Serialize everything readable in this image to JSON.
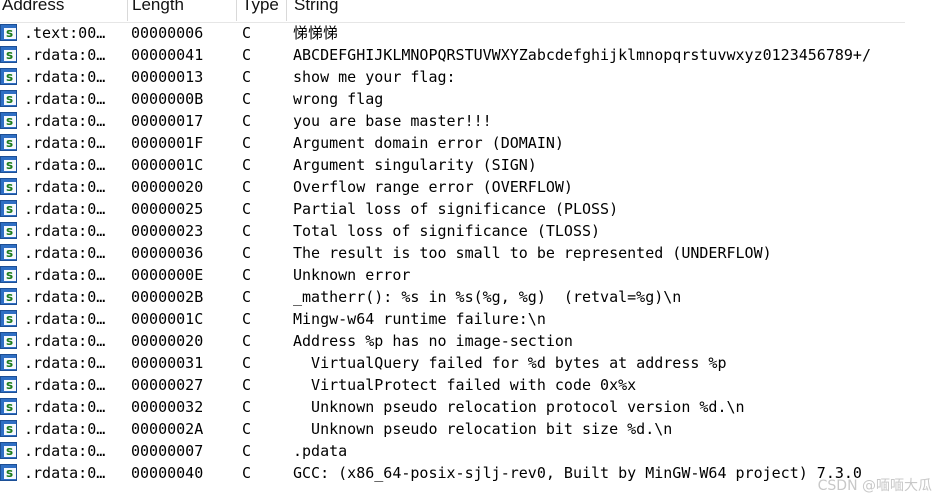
{
  "columns": {
    "address": "Address",
    "length": "Length",
    "type": "Type",
    "string": "String"
  },
  "row_icon": "string-literal-icon",
  "row_icon_glyph": "s",
  "rows": [
    {
      "address": ".text:00…",
      "length": "00000006",
      "type": "C",
      "string": "悌悌悌"
    },
    {
      "address": ".rdata:0…",
      "length": "00000041",
      "type": "C",
      "string": "ABCDEFGHIJKLMNOPQRSTUVWXYZabcdefghijklmnopqrstuvwxyz0123456789+/"
    },
    {
      "address": ".rdata:0…",
      "length": "00000013",
      "type": "C",
      "string": "show me your flag:"
    },
    {
      "address": ".rdata:0…",
      "length": "0000000B",
      "type": "C",
      "string": "wrong flag"
    },
    {
      "address": ".rdata:0…",
      "length": "00000017",
      "type": "C",
      "string": "you are base master!!!"
    },
    {
      "address": ".rdata:0…",
      "length": "0000001F",
      "type": "C",
      "string": "Argument domain error (DOMAIN)"
    },
    {
      "address": ".rdata:0…",
      "length": "0000001C",
      "type": "C",
      "string": "Argument singularity (SIGN)"
    },
    {
      "address": ".rdata:0…",
      "length": "00000020",
      "type": "C",
      "string": "Overflow range error (OVERFLOW)"
    },
    {
      "address": ".rdata:0…",
      "length": "00000025",
      "type": "C",
      "string": "Partial loss of significance (PLOSS)"
    },
    {
      "address": ".rdata:0…",
      "length": "00000023",
      "type": "C",
      "string": "Total loss of significance (TLOSS)"
    },
    {
      "address": ".rdata:0…",
      "length": "00000036",
      "type": "C",
      "string": "The result is too small to be represented (UNDERFLOW)"
    },
    {
      "address": ".rdata:0…",
      "length": "0000000E",
      "type": "C",
      "string": "Unknown error"
    },
    {
      "address": ".rdata:0…",
      "length": "0000002B",
      "type": "C",
      "string": "_matherr(): %s in %s(%g, %g)  (retval=%g)\\n"
    },
    {
      "address": ".rdata:0…",
      "length": "0000001C",
      "type": "C",
      "string": "Mingw-w64 runtime failure:\\n"
    },
    {
      "address": ".rdata:0…",
      "length": "00000020",
      "type": "C",
      "string": "Address %p has no image-section"
    },
    {
      "address": ".rdata:0…",
      "length": "00000031",
      "type": "C",
      "string": "  VirtualQuery failed for %d bytes at address %p"
    },
    {
      "address": ".rdata:0…",
      "length": "00000027",
      "type": "C",
      "string": "  VirtualProtect failed with code 0x%x"
    },
    {
      "address": ".rdata:0…",
      "length": "00000032",
      "type": "C",
      "string": "  Unknown pseudo relocation protocol version %d.\\n"
    },
    {
      "address": ".rdata:0…",
      "length": "0000002A",
      "type": "C",
      "string": "  Unknown pseudo relocation bit size %d.\\n"
    },
    {
      "address": ".rdata:0…",
      "length": "00000007",
      "type": "C",
      "string": ".pdata"
    },
    {
      "address": ".rdata:0…",
      "length": "00000040",
      "type": "C",
      "string": "GCC: (x86_64-posix-sjlj-rev0, Built by MinGW-W64 project) 7.3.0"
    }
  ],
  "watermark": "CSDN @喕喕大瓜"
}
